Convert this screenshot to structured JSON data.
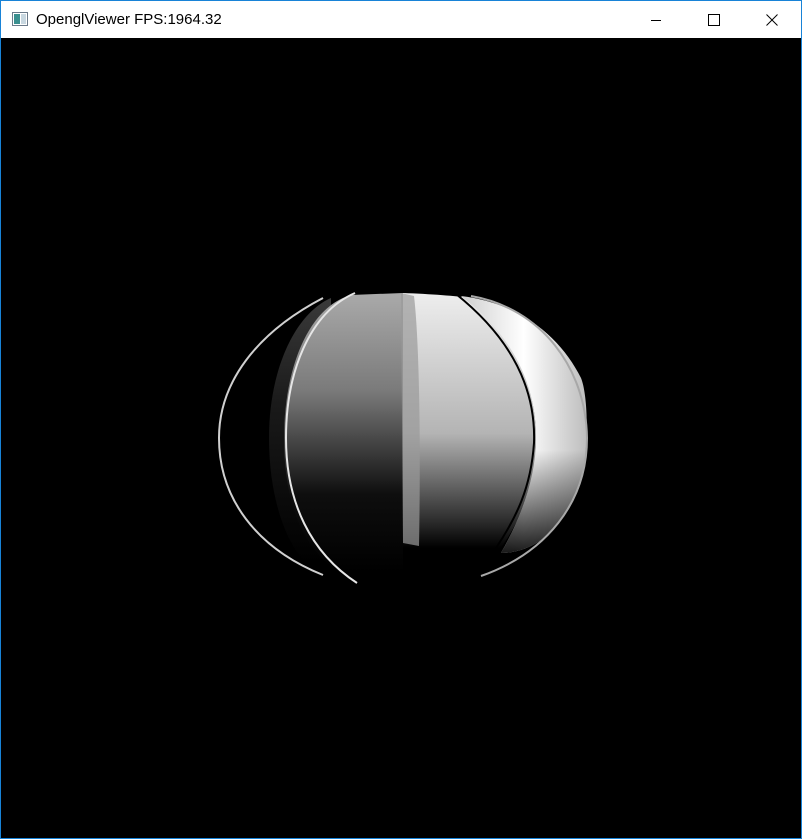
{
  "window": {
    "title": "OpenglViewer FPS:1964.32",
    "controls": {
      "minimize": "minimize-icon",
      "maximize": "maximize-icon",
      "close": "close-icon"
    }
  },
  "viewport": {
    "background": "#000000",
    "object": "shaded-sphere"
  },
  "colors": {
    "window_border": "#1883d7",
    "titlebar_bg": "#ffffff"
  }
}
